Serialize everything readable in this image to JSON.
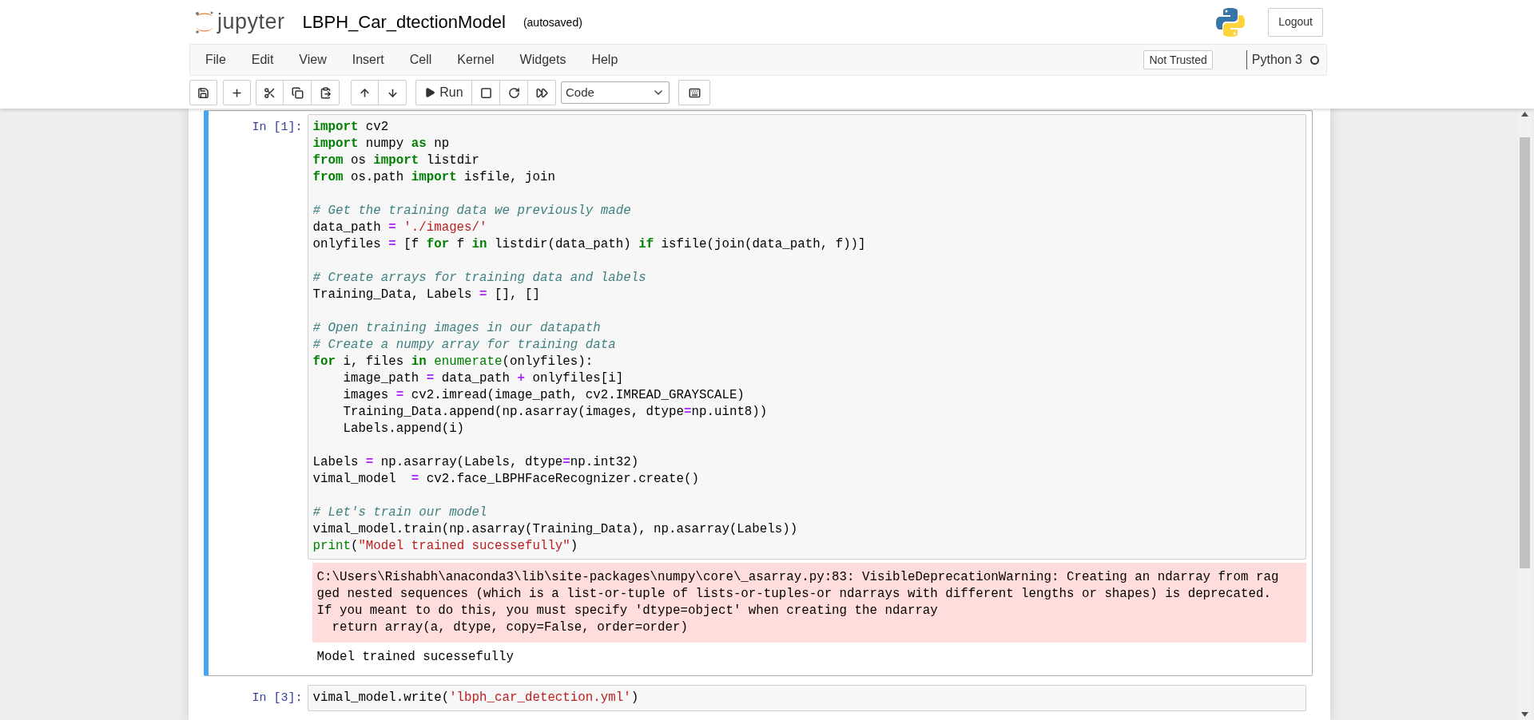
{
  "header": {
    "logo_text": "jupyter",
    "notebook_title": "LBPH_Car_dtectionModel",
    "save_status": "(autosaved)",
    "logout": "Logout"
  },
  "menu": [
    "File",
    "Edit",
    "View",
    "Insert",
    "Cell",
    "Kernel",
    "Widgets",
    "Help"
  ],
  "trust_button": "Not Trusted",
  "kernel": {
    "name": "Python 3",
    "busy": false
  },
  "toolbar": {
    "run_label": "Run",
    "cell_type": "Code"
  },
  "cells": [
    {
      "prompt": "In [1]:",
      "selected": true,
      "lines": [
        {
          "kind": "code",
          "tokens": [
            {
              "kind": "keyword",
              "t": "import"
            },
            {
              "kind": "plain",
              "t": " cv2"
            }
          ]
        },
        {
          "kind": "code",
          "tokens": [
            {
              "kind": "keyword",
              "t": "import"
            },
            {
              "kind": "plain",
              "t": " numpy "
            },
            {
              "kind": "keyword",
              "t": "as"
            },
            {
              "kind": "plain",
              "t": " np"
            }
          ]
        },
        {
          "kind": "code",
          "tokens": [
            {
              "kind": "keyword",
              "t": "from"
            },
            {
              "kind": "plain",
              "t": " os "
            },
            {
              "kind": "keyword",
              "t": "import"
            },
            {
              "kind": "plain",
              "t": " listdir"
            }
          ]
        },
        {
          "kind": "code",
          "tokens": [
            {
              "kind": "keyword",
              "t": "from"
            },
            {
              "kind": "plain",
              "t": " os.path "
            },
            {
              "kind": "keyword",
              "t": "import"
            },
            {
              "kind": "plain",
              "t": " isfile, join"
            }
          ]
        },
        {
          "kind": "blank"
        },
        {
          "kind": "code",
          "tokens": [
            {
              "kind": "comment",
              "t": "# Get the training data we previously made"
            }
          ]
        },
        {
          "kind": "code",
          "tokens": [
            {
              "kind": "plain",
              "t": "data_path "
            },
            {
              "kind": "operator",
              "t": "= "
            },
            {
              "kind": "string",
              "t": "'./images/'"
            }
          ]
        },
        {
          "kind": "code",
          "tokens": [
            {
              "kind": "plain",
              "t": "onlyfiles "
            },
            {
              "kind": "operator",
              "t": "="
            },
            {
              "kind": "plain",
              "t": " [f "
            },
            {
              "kind": "keyword",
              "t": "for"
            },
            {
              "kind": "plain",
              "t": " f "
            },
            {
              "kind": "keyword",
              "t": "in"
            },
            {
              "kind": "plain",
              "t": " listdir(data_path) "
            },
            {
              "kind": "keyword",
              "t": "if"
            },
            {
              "kind": "plain",
              "t": " isfile(join(data_path, f))]"
            }
          ]
        },
        {
          "kind": "blank"
        },
        {
          "kind": "code",
          "tokens": [
            {
              "kind": "comment",
              "t": "# Create arrays for training data and labels"
            }
          ]
        },
        {
          "kind": "code",
          "tokens": [
            {
              "kind": "plain",
              "t": "Training_Data, Labels "
            },
            {
              "kind": "operator",
              "t": "="
            },
            {
              "kind": "plain",
              "t": " [], []"
            }
          ]
        },
        {
          "kind": "blank"
        },
        {
          "kind": "code",
          "tokens": [
            {
              "kind": "comment",
              "t": "# Open training images in our datapath"
            }
          ]
        },
        {
          "kind": "code",
          "tokens": [
            {
              "kind": "comment",
              "t": "# Create a numpy array for training data"
            }
          ]
        },
        {
          "kind": "code",
          "tokens": [
            {
              "kind": "keyword",
              "t": "for"
            },
            {
              "kind": "plain",
              "t": " i, files "
            },
            {
              "kind": "keyword",
              "t": "in "
            },
            {
              "kind": "builtin",
              "t": "enumerate"
            },
            {
              "kind": "plain",
              "t": "(onlyfiles):"
            }
          ]
        },
        {
          "kind": "code",
          "tokens": [
            {
              "kind": "plain",
              "t": "    image_path "
            },
            {
              "kind": "operator",
              "t": "="
            },
            {
              "kind": "plain",
              "t": " data_path "
            },
            {
              "kind": "operator",
              "t": "+"
            },
            {
              "kind": "plain",
              "t": " onlyfiles[i]"
            }
          ]
        },
        {
          "kind": "code",
          "tokens": [
            {
              "kind": "plain",
              "t": "    images "
            },
            {
              "kind": "operator",
              "t": "="
            },
            {
              "kind": "plain",
              "t": " cv2.imread(image_path, cv2.IMREAD_GRAYSCALE)"
            }
          ]
        },
        {
          "kind": "code",
          "tokens": [
            {
              "kind": "plain",
              "t": "    Training_Data.append(np.asarray(images, dtype"
            },
            {
              "kind": "operator",
              "t": "="
            },
            {
              "kind": "plain",
              "t": "np.uint8))"
            }
          ]
        },
        {
          "kind": "code",
          "tokens": [
            {
              "kind": "plain",
              "t": "    Labels.append(i)"
            }
          ]
        },
        {
          "kind": "blank"
        },
        {
          "kind": "code",
          "tokens": [
            {
              "kind": "plain",
              "t": "Labels "
            },
            {
              "kind": "operator",
              "t": "="
            },
            {
              "kind": "plain",
              "t": " np.asarray(Labels, dtype"
            },
            {
              "kind": "operator",
              "t": "="
            },
            {
              "kind": "plain",
              "t": "np.int32)"
            }
          ]
        },
        {
          "kind": "code",
          "tokens": [
            {
              "kind": "plain",
              "t": "vimal_model  "
            },
            {
              "kind": "operator",
              "t": "="
            },
            {
              "kind": "plain",
              "t": " cv2.face_LBPHFaceRecognizer.create()"
            }
          ]
        },
        {
          "kind": "blank"
        },
        {
          "kind": "code",
          "tokens": [
            {
              "kind": "comment",
              "t": "# Let's train our model"
            }
          ]
        },
        {
          "kind": "code",
          "tokens": [
            {
              "kind": "plain",
              "t": "vimal_model.train(np.asarray(Training_Data), np.asarray(Labels))"
            }
          ]
        },
        {
          "kind": "code",
          "tokens": [
            {
              "kind": "builtin",
              "t": "print"
            },
            {
              "kind": "plain",
              "t": "("
            },
            {
              "kind": "string",
              "t": "\"Model trained sucessefully\""
            },
            {
              "kind": "plain",
              "t": ")"
            }
          ]
        }
      ],
      "outputs": [
        {
          "kind": "stderr",
          "lines": [
            "C:\\Users\\Rishabh\\anaconda3\\lib\\site-packages\\numpy\\core\\_asarray.py:83: VisibleDeprecationWarning: Creating an ndarray from rag",
            "ged nested sequences (which is a list-or-tuple of lists-or-tuples-or ndarrays with different lengths or shapes) is deprecated.",
            "If you meant to do this, you must specify 'dtype=object' when creating the ndarray",
            "  return array(a, dtype, copy=False, order=order)"
          ]
        },
        {
          "kind": "stdout",
          "lines": [
            "Model trained sucessefully"
          ]
        }
      ]
    },
    {
      "prompt": "In [3]:",
      "selected": false,
      "lines": [
        {
          "kind": "code",
          "tokens": [
            {
              "kind": "plain",
              "t": "vimal_model.write("
            },
            {
              "kind": "string",
              "t": "'lbph_car_detection.yml'"
            },
            {
              "kind": "plain",
              "t": ")"
            }
          ]
        }
      ]
    }
  ]
}
